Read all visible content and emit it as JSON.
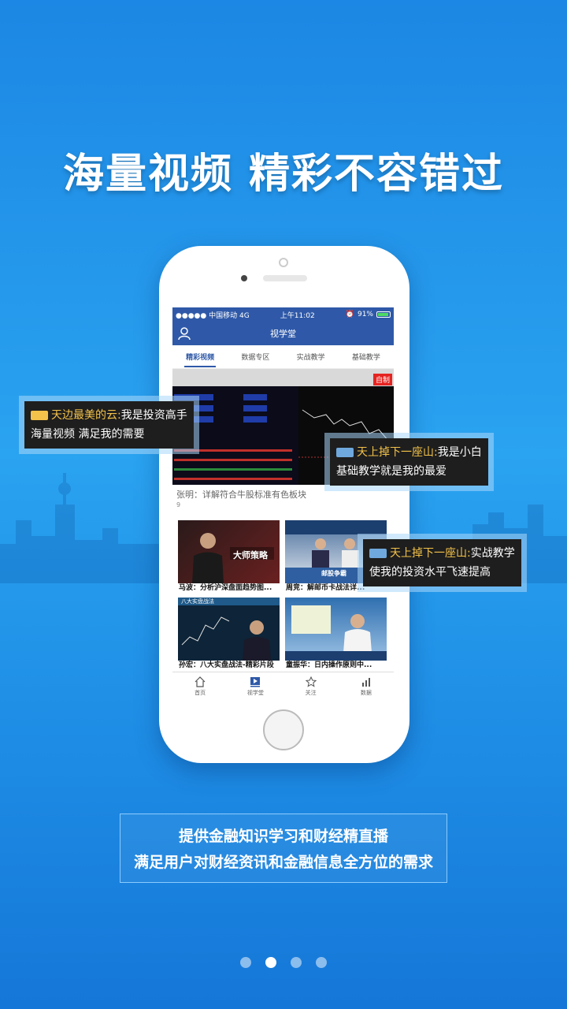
{
  "headline": "海量视频  精彩不容错过",
  "status_bar": {
    "carrier": "●●●●● 中国移动  4G",
    "time": "上午11:02",
    "battery": "91%"
  },
  "header": {
    "title": "视学堂"
  },
  "tabs": [
    {
      "label": "精彩视频",
      "active": true
    },
    {
      "label": "数据专区"
    },
    {
      "label": "实战教学"
    },
    {
      "label": "基础教学"
    }
  ],
  "hero": {
    "badge": "自制",
    "caption": "张明：详解符合牛股标准有色板块",
    "sub": "9"
  },
  "videos": [
    {
      "caption": "马波：分析沪深盘面趋势图...",
      "overlay": "大师策略"
    },
    {
      "caption": "周竞：解邮币卡战法详...",
      "overlay": "邮股争霸"
    },
    {
      "caption": "孙宏：八大实盘战法-精彩片段",
      "overlay": "八大实盘战法"
    },
    {
      "caption": "童振华：日内操作原则中...",
      "overlay": ""
    }
  ],
  "bottom_nav": [
    {
      "label": "首页",
      "icon": "home-icon"
    },
    {
      "label": "视学堂",
      "icon": "play-icon"
    },
    {
      "label": "关注",
      "icon": "star-icon"
    },
    {
      "label": "数据",
      "icon": "chart-icon"
    }
  ],
  "bubbles": [
    {
      "name": "天边最美的云:",
      "line1": "我是投资高手",
      "line2": "海量视频 满足我的需要"
    },
    {
      "name": "天上掉下一座山:",
      "line1": "我是小白",
      "line2": "基础教学就是我的最爱"
    },
    {
      "name": "天上掉下一座山:",
      "line1": "实战教学",
      "line2": "使我的投资水平飞速提高"
    }
  ],
  "bottom_text": {
    "line1": "提供金融知识学习和财经精直播",
    "line2": "满足用户对财经资讯和金融信息全方位的需求"
  },
  "pagination": {
    "count": 4,
    "active_index": 1
  },
  "colors": {
    "accent": "#2f59a8",
    "bubble_name": "#f3c24a",
    "badge_red": "#e52421"
  }
}
